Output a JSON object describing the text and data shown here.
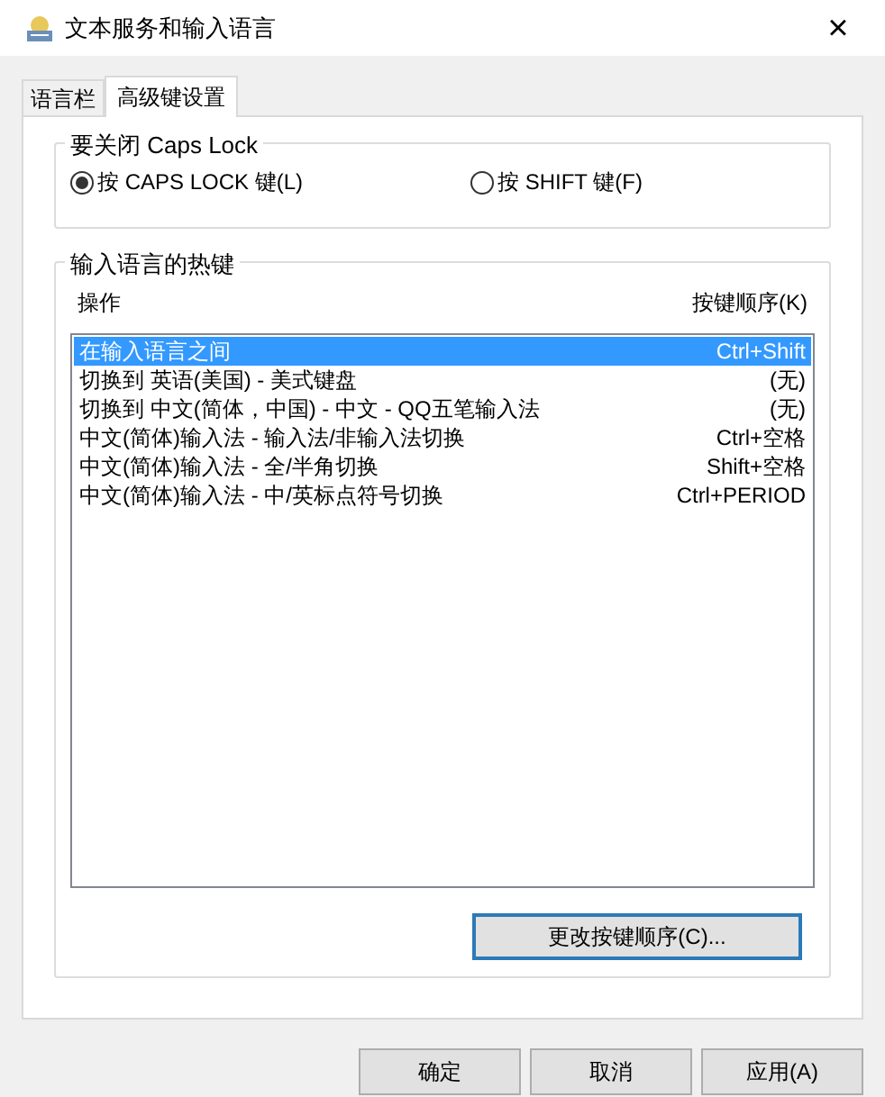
{
  "window": {
    "title": "文本服务和输入语言",
    "close": "×"
  },
  "tabs": [
    {
      "label": "语言栏",
      "selected": false
    },
    {
      "label": "高级键设置",
      "selected": true
    }
  ],
  "caps_lock_group": {
    "title": "要关闭 Caps Lock",
    "options": [
      {
        "label": "按 CAPS LOCK 键(L)",
        "selected": true
      },
      {
        "label": "按 SHIFT 键(F)",
        "selected": false
      }
    ]
  },
  "hotkeys_group": {
    "title": "输入语言的热键",
    "columns": [
      "操作",
      "按键顺序(K)"
    ],
    "rows": [
      {
        "action": "在输入语言之间",
        "keys": "Ctrl+Shift",
        "selected": true
      },
      {
        "action": "切换到 英语(美国) - 美式键盘",
        "keys": "(无)",
        "selected": false
      },
      {
        "action": "切换到 中文(简体，中国) - 中文 - QQ五笔输入法",
        "keys": "(无)",
        "selected": false
      },
      {
        "action": "中文(简体)输入法 - 输入法/非输入法切换",
        "keys": "Ctrl+空格",
        "selected": false
      },
      {
        "action": "中文(简体)输入法 - 全/半角切换",
        "keys": "Shift+空格",
        "selected": false
      },
      {
        "action": "中文(简体)输入法 - 中/英标点符号切换",
        "keys": "Ctrl+PERIOD",
        "selected": false
      }
    ],
    "button": "更改按键顺序(C)..."
  },
  "buttons": [
    "确定",
    "取消",
    "应用(A)"
  ]
}
